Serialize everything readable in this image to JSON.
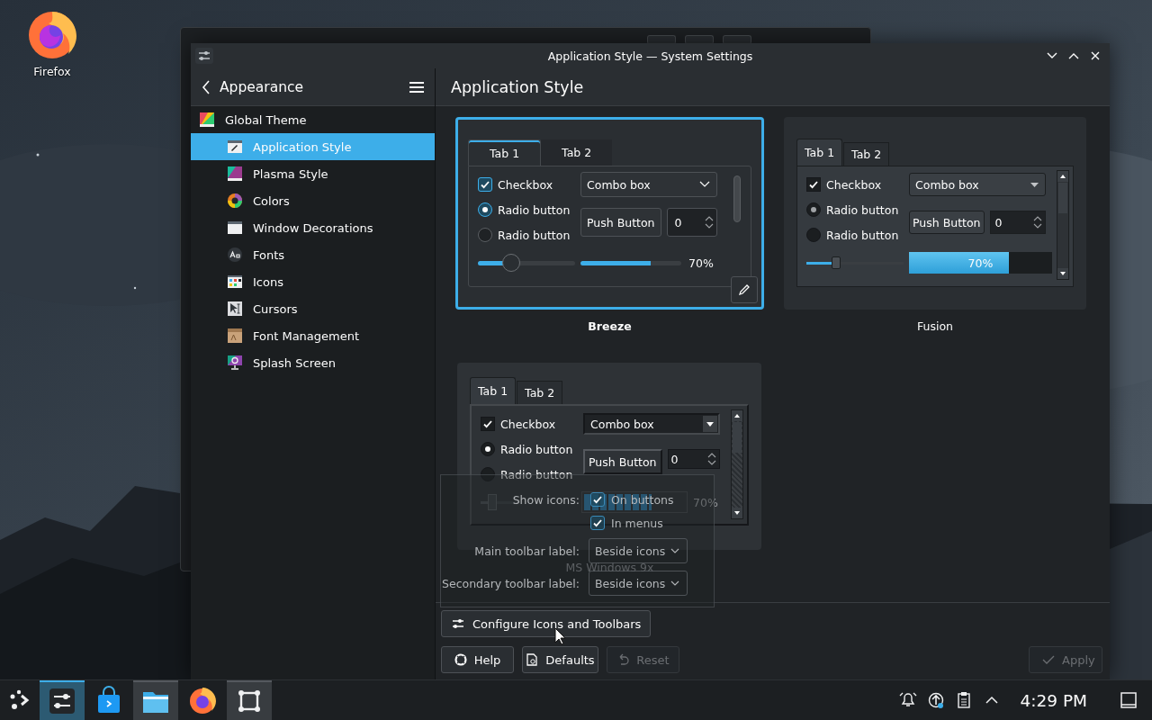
{
  "desktop": {
    "icons": [
      {
        "label": "Firefox"
      }
    ]
  },
  "window": {
    "title": "Application Style — System Settings"
  },
  "sidebar": {
    "title": "Appearance",
    "items": [
      {
        "label": "Global Theme",
        "selected": false,
        "children": [
          {
            "label": "Application Style",
            "selected": true
          },
          {
            "label": "Plasma Style",
            "selected": false
          },
          {
            "label": "Colors",
            "selected": false
          },
          {
            "label": "Window Decorations",
            "selected": false
          },
          {
            "label": "Fonts",
            "selected": false
          },
          {
            "label": "Icons",
            "selected": false
          },
          {
            "label": "Cursors",
            "selected": false
          },
          {
            "label": "Font Management",
            "selected": false
          },
          {
            "label": "Splash Screen",
            "selected": false
          }
        ]
      }
    ]
  },
  "page": {
    "title": "Application Style",
    "styles": [
      {
        "name": "Breeze",
        "kind": "breeze",
        "selected": true,
        "tabs": [
          {
            "label": "Tab 1",
            "selected": true
          },
          {
            "label": "Tab 2",
            "selected": false
          }
        ],
        "checkbox": {
          "label": "Checkbox",
          "checked": true
        },
        "radios": [
          {
            "label": "Radio button",
            "selected": true
          },
          {
            "label": "Radio button",
            "selected": false
          }
        ],
        "combo": "Combo box",
        "push_button": "Push Button",
        "spin_value": "0",
        "slider": {
          "level": 0.34
        },
        "progress": {
          "level": 0.7,
          "reading": "70%"
        }
      },
      {
        "name": "Fusion",
        "kind": "fusion",
        "selected": false,
        "tabs": [
          {
            "label": "Tab 1",
            "selected": true
          },
          {
            "label": "Tab 2",
            "selected": false
          }
        ],
        "checkbox": {
          "label": "Checkbox",
          "checked": true
        },
        "radios": [
          {
            "label": "Radio button",
            "selected": true
          },
          {
            "label": "Radio button",
            "selected": false
          }
        ],
        "combo": "Combo box",
        "push_button": "Push Button",
        "spin_value": "0",
        "slider": {
          "level": 0.31
        },
        "progress": {
          "level": 0.7,
          "reading": "70%"
        }
      },
      {
        "name": "MS Windows 9x",
        "kind": "windows",
        "selected": false,
        "tabs": [
          {
            "label": "Tab 1",
            "selected": true
          },
          {
            "label": "Tab 2",
            "selected": false
          }
        ],
        "checkbox": {
          "label": "Checkbox",
          "checked": true
        },
        "radios": [
          {
            "label": "Radio button",
            "selected": true
          },
          {
            "label": "Radio button",
            "selected": false
          }
        ],
        "combo": "Combo box",
        "push_button": "Push Button",
        "spin_value": "0",
        "slider": {
          "level": 0.3
        },
        "progress": {
          "level": 0.67,
          "reading": "70%"
        }
      }
    ],
    "icon_settings": {
      "show_icons_label": "Show icons:",
      "options": [
        {
          "label": "On buttons",
          "checked": true
        },
        {
          "label": "In menus",
          "checked": true
        }
      ],
      "fields": [
        {
          "label": "Main toolbar label:",
          "value": "Beside icons"
        },
        {
          "label": "Secondary toolbar label:",
          "value": "Beside icons"
        }
      ]
    },
    "configure_button": "Configure Icons and Toolbars",
    "buttons": [
      {
        "label": "Help",
        "disabled": false
      },
      {
        "label": "Defaults",
        "disabled": false
      },
      {
        "label": "Reset",
        "disabled": true
      },
      {
        "label": "Apply",
        "disabled": true
      }
    ]
  },
  "taskbar": {
    "tasks": [
      {
        "running": true,
        "selected": true
      },
      {
        "running": false,
        "selected": false
      },
      {
        "running": true,
        "selected": false
      },
      {
        "running": false,
        "selected": false
      },
      {
        "running": true,
        "selected": false
      }
    ],
    "clock": "4:29 PM"
  }
}
